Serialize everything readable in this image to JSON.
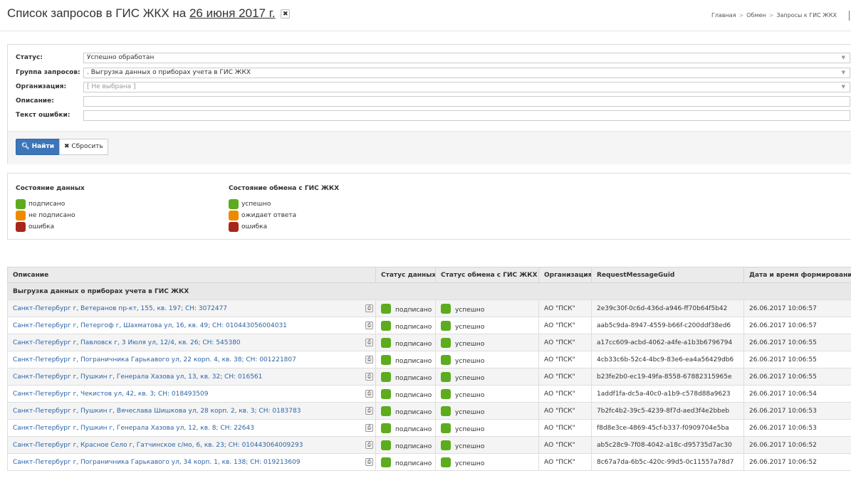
{
  "header": {
    "title_prefix": "Список запросов в ГИС ЖКХ на",
    "title_date": "26 июня 2017 г.",
    "title_close": "✖",
    "breadcrumb": [
      "Главная",
      "Обмен",
      "Запросы к ГИС ЖКХ"
    ]
  },
  "filters": {
    "status": {
      "label": "Статус:",
      "value": "Успешно обработан"
    },
    "group": {
      "label": "Группа запросов:",
      "value": ". Выгрузка данных о приборах учета в ГИС ЖКХ"
    },
    "organization": {
      "label": "Организация:",
      "value": "[ Не выбрана ]"
    },
    "description": {
      "label": "Описание:",
      "value": ""
    },
    "error_text": {
      "label": "Текст ошибки:",
      "value": ""
    },
    "find_label": "Найти",
    "reset_label": "Сбросить"
  },
  "legend": {
    "data_state": {
      "title": "Состояние данных",
      "items": [
        {
          "label": "подписано",
          "color": "#5cac1e"
        },
        {
          "label": "не подписано",
          "color": "#ee8a00"
        },
        {
          "label": "ошибка",
          "color": "#a7281b"
        }
      ]
    },
    "exchange_state": {
      "title": "Состояние обмена с ГИС ЖКХ",
      "items": [
        {
          "label": "успешно",
          "color": "#5cac1e"
        },
        {
          "label": "ожидает ответа",
          "color": "#ee8a00"
        },
        {
          "label": "ошибка",
          "color": "#a7281b"
        }
      ]
    }
  },
  "table": {
    "columns": [
      "Описание",
      "Статус данных",
      "Статус обмена с ГИС ЖКХ",
      "Организация",
      "RequestMessageGuid",
      "Дата и время формирования"
    ],
    "group_title": "Выгрузка данных о приборах учета в ГИС ЖКХ",
    "rows": [
      {
        "desc": "Санкт-Петербург г, Ветеранов пр-кт, 155, кв. 197; СН: 3072477",
        "data_status": "подписано",
        "exchange_status": "успешно",
        "org": "АО \"ПСК\"",
        "guid": "2e39c30f-0c6d-436d-a946-ff70b64f5b42",
        "date": "26.06.2017 10:06:57"
      },
      {
        "desc": "Санкт-Петербург г, Петергоф г, Шахматова ул, 16, кв. 49; СН: 010443056004031",
        "data_status": "подписано",
        "exchange_status": "успешно",
        "org": "АО \"ПСК\"",
        "guid": "aab5c9da-8947-4559-b66f-c200ddf38ed6",
        "date": "26.06.2017 10:06:57"
      },
      {
        "desc": "Санкт-Петербург г, Павловск г, 3 Июля ул, 12/4, кв. 26; СН: 545380",
        "data_status": "подписано",
        "exchange_status": "успешно",
        "org": "АО \"ПСК\"",
        "guid": "a17cc609-acbd-4062-a4fe-a1b3b6796794",
        "date": "26.06.2017 10:06:55"
      },
      {
        "desc": "Санкт-Петербург г, Пограничника Гарькавого ул, 22 корп. 4, кв. 38; СН: 001221807",
        "data_status": "подписано",
        "exchange_status": "успешно",
        "org": "АО \"ПСК\"",
        "guid": "4cb33c6b-52c4-4bc9-83e6-ea4a56429db6",
        "date": "26.06.2017 10:06:55"
      },
      {
        "desc": "Санкт-Петербург г, Пушкин г, Генерала Хазова ул, 13, кв. 32; СН: 016561",
        "data_status": "подписано",
        "exchange_status": "успешно",
        "org": "АО \"ПСК\"",
        "guid": "b23fe2b0-ec19-49fa-8558-67882315965e",
        "date": "26.06.2017 10:06:55"
      },
      {
        "desc": "Санкт-Петербург г, Чекистов ул, 42, кв. 3; СН: 018493509",
        "data_status": "подписано",
        "exchange_status": "успешно",
        "org": "АО \"ПСК\"",
        "guid": "1addf1fa-dc5a-40c0-a1b9-c578d88a9623",
        "date": "26.06.2017 10:06:54"
      },
      {
        "desc": "Санкт-Петербург г, Пушкин г, Вячеслава Шишкова ул, 28 корп. 2, кв. 3; СН: 0183783",
        "data_status": "подписано",
        "exchange_status": "успешно",
        "org": "АО \"ПСК\"",
        "guid": "7b2fc4b2-39c5-4239-8f7d-aed3f4e2bbeb",
        "date": "26.06.2017 10:06:53"
      },
      {
        "desc": "Санкт-Петербург г, Пушкин г, Генерала Хазова ул, 12, кв. 8; СН: 22643",
        "data_status": "подписано",
        "exchange_status": "успешно",
        "org": "АО \"ПСК\"",
        "guid": "f8d8e3ce-4869-45cf-b337-f0909704e5ba",
        "date": "26.06.2017 10:06:53"
      },
      {
        "desc": "Санкт-Петербург г, Красное Село г, Гатчинское с/мо, 6, кв. 23; СН: 010443064009293",
        "data_status": "подписано",
        "exchange_status": "успешно",
        "org": "АО \"ПСК\"",
        "guid": "ab5c28c9-7f08-4042-a18c-d95735d7ac30",
        "date": "26.06.2017 10:06:52"
      },
      {
        "desc": "Санкт-Петербург г, Пограничника Гарькавого ул, 34 корп. 1, кв. 138; СН: 019213609",
        "data_status": "подписано",
        "exchange_status": "успешно",
        "org": "АО \"ПСК\"",
        "guid": "8c67a7da-6b5c-420c-99d5-0c11557a78d7",
        "date": "26.06.2017 10:06:52"
      }
    ]
  },
  "colors": {
    "success": "#5cac1e",
    "pending": "#ee8a00",
    "error": "#a7281b",
    "link": "#2d64a6",
    "primary": "#3c76b8"
  }
}
